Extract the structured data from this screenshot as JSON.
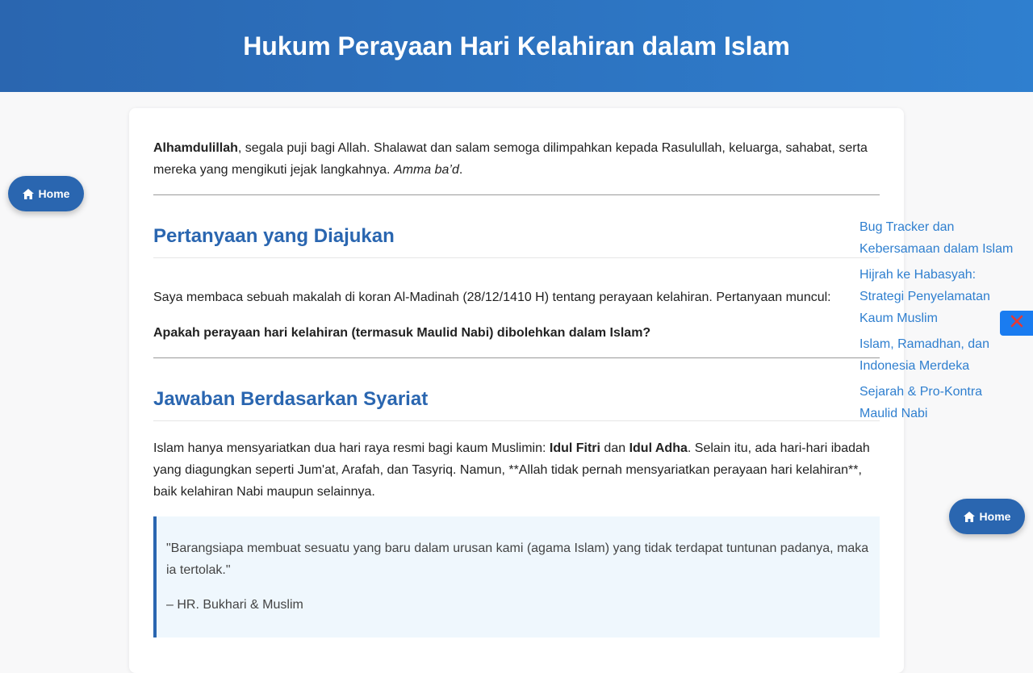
{
  "header": {
    "title": "Hukum Perayaan Hari Kelahiran dalam Islam"
  },
  "intro": {
    "bold": "Alhamdulillah",
    "text": ", segala puji bagi Allah. Shalawat dan salam semoga dilimpahkan kepada Rasulullah, keluarga, sahabat, serta mereka yang mengikuti jejak langkahnya. ",
    "italic": "Amma ba’d",
    "end": "."
  },
  "section1": {
    "heading": "Pertanyaan yang Diajukan",
    "paragraph": "Saya membaca sebuah makalah di koran Al-Madinah (28/12/1410 H) tentang perayaan kelahiran. Pertanyaan muncul:",
    "question": "Apakah perayaan hari kelahiran (termasuk Maulid Nabi) dibolehkan dalam Islam?"
  },
  "section2": {
    "heading": "Jawaban Berdasarkan Syariat",
    "p_start": "Islam hanya mensyariatkan dua hari raya resmi bagi kaum Muslimin: ",
    "bold1": "Idul Fitri",
    "p_mid": " dan ",
    "bold2": "Idul Adha",
    "p_end": ". Selain itu, ada hari-hari ibadah yang diagungkan seperti Jum'at, Arafah, dan Tasyriq. Namun, **Allah tidak pernah mensyariatkan perayaan hari kelahiran**, baik kelahiran Nabi maupun selainnya.",
    "quote_text": "\"Barangsiapa membuat sesuatu yang baru dalam urusan kami (agama Islam) yang tidak terdapat tuntunan padanya, maka ia tertolak.\"",
    "quote_source": "– HR. Bukhari & Muslim"
  },
  "buttons": {
    "home_label": "Home"
  },
  "related_links": [
    {
      "label": "Bug Tracker dan Kebersamaan dalam Islam"
    },
    {
      "label": "Hijrah ke Habasyah: Strategi Penyelamatan Kaum Muslim"
    },
    {
      "label": "Islam, Ramadhan, dan Indonesia Merdeka"
    },
    {
      "label": "Sejarah & Pro-Kontra Maulid Nabi"
    }
  ],
  "icons": {
    "home": "home-icon",
    "close": "close-icon"
  },
  "colors": {
    "primary": "#2a66b0",
    "link": "#2f7fcf",
    "close_bg": "#1a7cf0",
    "close_x": "#e53935"
  }
}
